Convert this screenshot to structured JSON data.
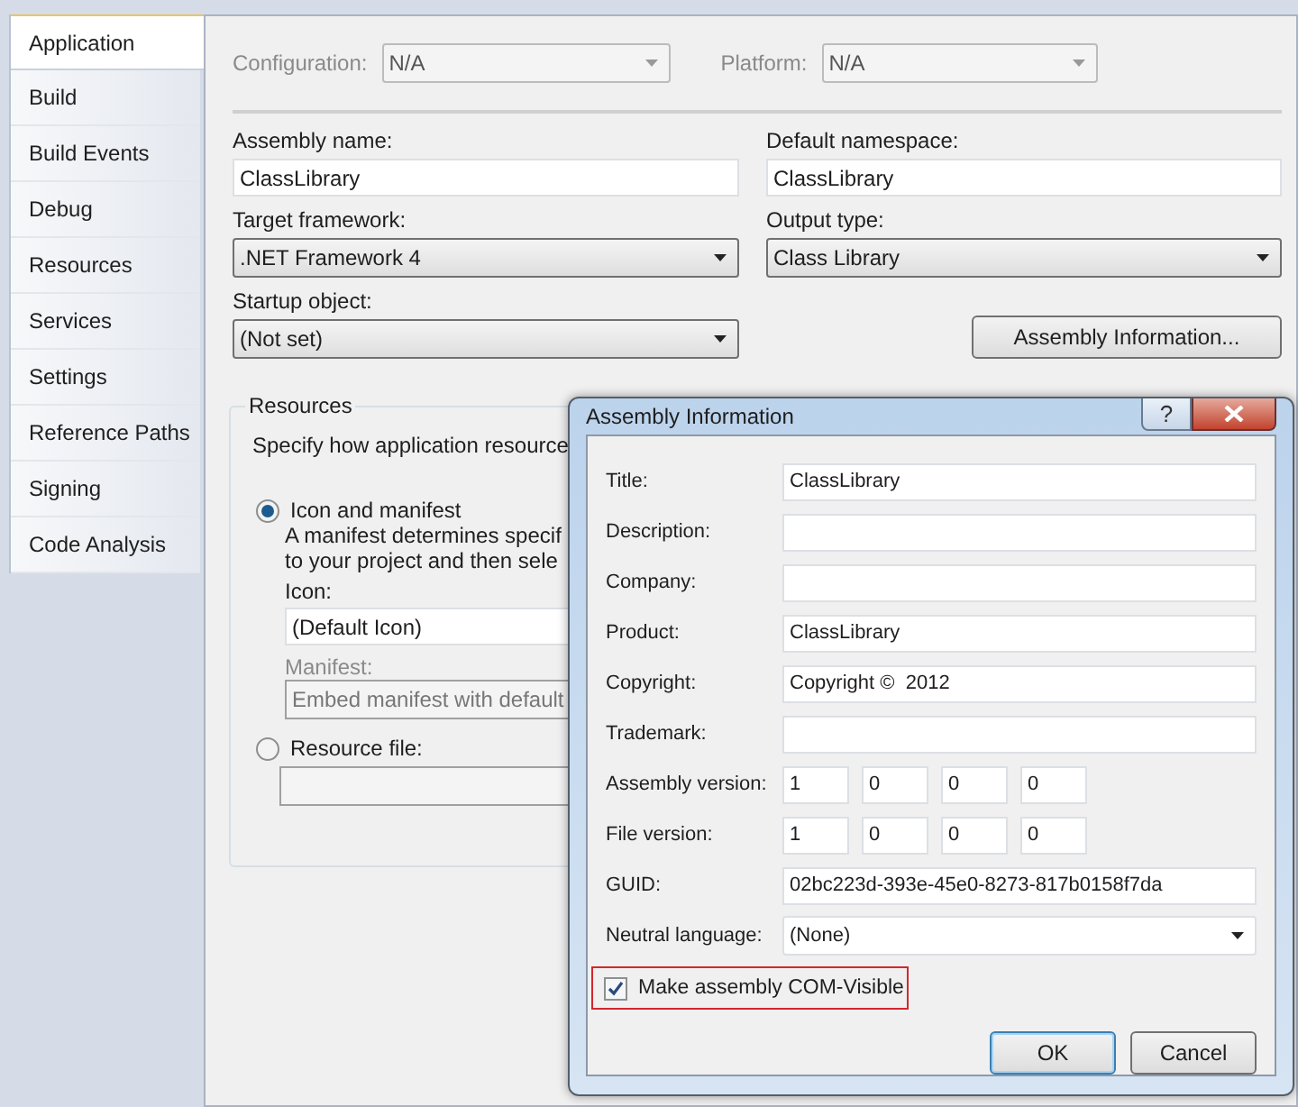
{
  "sidebar": {
    "tabs": [
      {
        "label": "Application",
        "selected": true
      },
      {
        "label": "Build",
        "selected": false
      },
      {
        "label": "Build Events",
        "selected": false
      },
      {
        "label": "Debug",
        "selected": false
      },
      {
        "label": "Resources",
        "selected": false
      },
      {
        "label": "Services",
        "selected": false
      },
      {
        "label": "Settings",
        "selected": false
      },
      {
        "label": "Reference Paths",
        "selected": false
      },
      {
        "label": "Signing",
        "selected": false
      },
      {
        "label": "Code Analysis",
        "selected": false
      }
    ]
  },
  "config": {
    "configuration_label": "Configuration:",
    "configuration_value": "N/A",
    "platform_label": "Platform:",
    "platform_value": "N/A",
    "disabled": true
  },
  "fields": [
    {
      "label": "Assembly name:",
      "value": "ClassLibrary",
      "kind": "text"
    },
    {
      "label": "Default namespace:",
      "value": "ClassLibrary",
      "kind": "text"
    },
    {
      "label": "Target framework:",
      "value": ".NET Framework 4",
      "kind": "dropdown"
    },
    {
      "label": "Output type:",
      "value": "Class Library",
      "kind": "dropdown"
    },
    {
      "label": "Startup object:",
      "value": "(Not set)",
      "kind": "dropdown"
    }
  ],
  "assembly_info_button": "Assembly Information...",
  "resources": {
    "title": "Resources",
    "description": "Specify how application resource",
    "options": [
      {
        "label": "Icon and manifest",
        "selected": true
      },
      {
        "label": "Resource file:",
        "selected": false
      }
    ],
    "manifest_note": [
      "A manifest determines specif",
      "to your project and then sele"
    ],
    "icon_label": "Icon:",
    "icon_value": "(Default Icon)",
    "manifest_label": "Manifest:",
    "manifest_value": "Embed manifest with default",
    "manifest_disabled": true
  },
  "dialog": {
    "title": "Assembly Information",
    "help": "?",
    "fields": [
      {
        "label": "Title:",
        "value": "ClassLibrary",
        "kind": "text"
      },
      {
        "label": "Description:",
        "kind": "text"
      },
      {
        "label": "Company:",
        "kind": "text"
      },
      {
        "label": "Product:",
        "value": "ClassLibrary",
        "kind": "text"
      },
      {
        "label": "Copyright:",
        "value": "Copyright ©  2012",
        "kind": "text"
      },
      {
        "label": "Trademark:",
        "kind": "text"
      },
      {
        "label": "Assembly version:",
        "parts": [
          "1",
          "0",
          "0",
          "0"
        ],
        "kind": "version"
      },
      {
        "label": "File version:",
        "parts": [
          "1",
          "0",
          "0",
          "0"
        ],
        "kind": "version"
      },
      {
        "label": "GUID:",
        "value": "02bc223d-393e-45e0-8273-817b0158f7da",
        "kind": "text"
      },
      {
        "label": "Neutral language:",
        "value": "(None)",
        "kind": "dropdown"
      }
    ],
    "com_visible": {
      "label": "Make assembly COM-Visible",
      "checked": true,
      "highlighted": true
    },
    "buttons": [
      {
        "label": "OK",
        "default": true
      },
      {
        "label": "Cancel",
        "default": false
      }
    ]
  }
}
